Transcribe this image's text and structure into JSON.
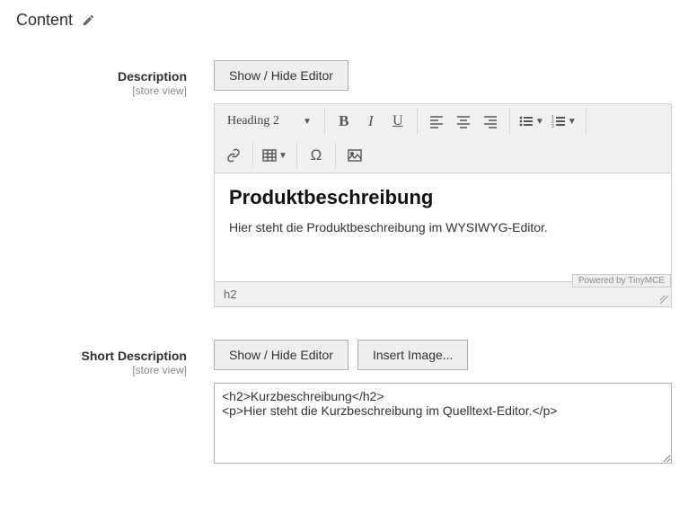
{
  "section_title": "Content",
  "description": {
    "label": "Description",
    "scope": "[store view]",
    "toggle_button": "Show / Hide Editor",
    "format_dropdown": "Heading 2",
    "content_heading": "Produktbeschreibung",
    "content_paragraph": "Hier steht die Produktbeschreibung im WYSIWYG-Editor.",
    "powered_by": "Powered by TinyMCE",
    "status_path": "h2"
  },
  "short_description": {
    "label": "Short Description",
    "scope": "[store view]",
    "toggle_button": "Show / Hide Editor",
    "insert_image_button": "Insert Image...",
    "raw_value": "<h2>Kurzbeschreibung</h2>\n<p>Hier steht die Kurzbeschreibung im Quelltext-Editor.</p>"
  },
  "toolbar_icons": {
    "bold": "B",
    "italic": "I",
    "underline": "U",
    "link": "link-icon",
    "table": "table-icon",
    "omega": "Ω",
    "image": "image-icon"
  }
}
